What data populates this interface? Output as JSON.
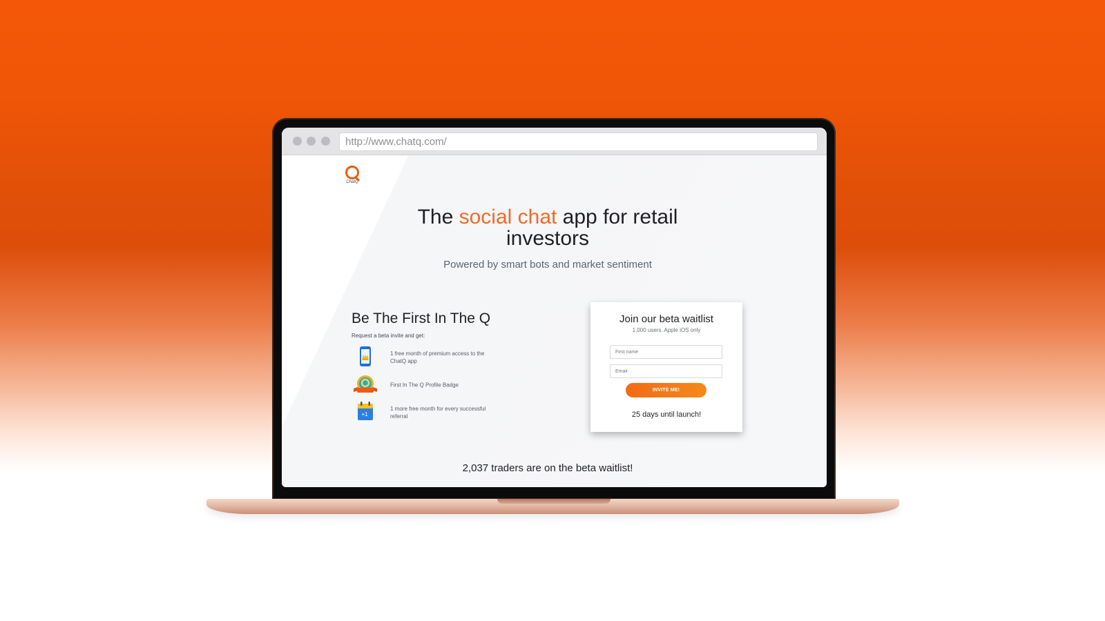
{
  "browser": {
    "url": "http://www.chatq.com/"
  },
  "logo": {
    "text": "ChatQ"
  },
  "hero": {
    "headline_before": "The ",
    "headline_accent": "social chat",
    "headline_after": " app for retail investors",
    "subhead": "Powered by smart bots and market sentiment"
  },
  "perks": {
    "title": "Be The First In The Q",
    "intro": "Request a beta invite and get:",
    "items": [
      {
        "icon": "phone-crown-icon",
        "text": "1 free month of premium access to the ChatQ app"
      },
      {
        "icon": "badge-ribbon-icon",
        "text": "First In The Q Profile Badge"
      },
      {
        "icon": "calendar-plus-one-icon",
        "text": "1 more free month for every successful referral",
        "badge": "+1"
      }
    ]
  },
  "signup": {
    "title": "Join our beta waitlist",
    "subtitle": "1,000 users. Apple iOS only",
    "first_name_placeholder": "First name",
    "email_placeholder": "Email",
    "button_label": "INVITE ME!",
    "countdown": "25 days until launch!"
  },
  "footer": {
    "waitlist_count": "2,037 traders are on the beta waitlist!"
  },
  "colors": {
    "accent": "#ef6a26",
    "button": "#f26b16"
  }
}
